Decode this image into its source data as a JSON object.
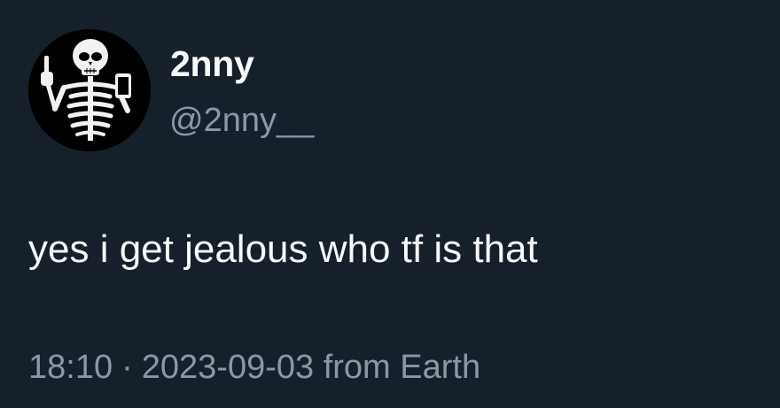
{
  "tweet": {
    "author": {
      "display_name": "2nny",
      "handle": "@2nny__",
      "avatar_icon": "skeleton-avatar-icon"
    },
    "text": "yes i get jealous who tf is that",
    "time": "18:10",
    "separator": "·",
    "date": "2023-09-03",
    "source": "from Earth"
  },
  "colors": {
    "background": "#15202b",
    "primary_text": "#f7f9f9",
    "secondary_text": "#8b98a5"
  }
}
